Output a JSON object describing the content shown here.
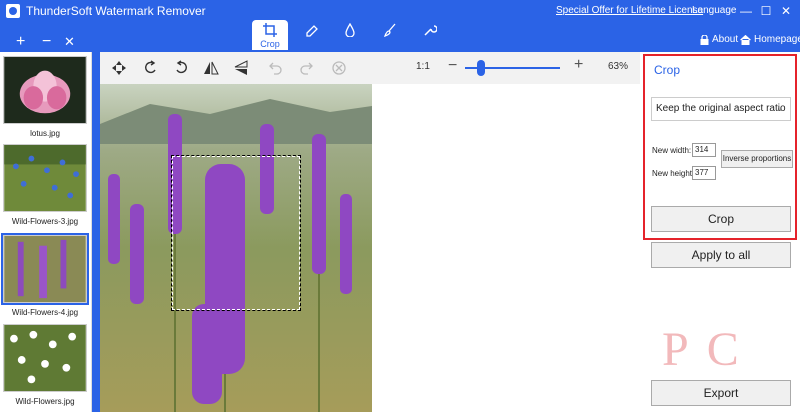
{
  "app": {
    "title": "ThunderSoft Watermark Remover",
    "special_offer": "Special Offer for Lifetime License",
    "language": "Language",
    "about": "About",
    "homepage": "Homepage"
  },
  "tools": [
    {
      "name": "crop",
      "label": "Crop",
      "active": true
    },
    {
      "name": "eraser",
      "label": ""
    },
    {
      "name": "fill",
      "label": ""
    },
    {
      "name": "brush",
      "label": ""
    },
    {
      "name": "wrench",
      "label": ""
    }
  ],
  "sidebar": {
    "files": [
      {
        "caption": "lotus.jpg",
        "selected": false
      },
      {
        "caption": "Wild-Flowers-3.jpg",
        "selected": false
      },
      {
        "caption": "Wild-Flowers-4.jpg",
        "selected": true
      },
      {
        "caption": "Wild-Flowers.jpg",
        "selected": false
      }
    ]
  },
  "toolbar": {
    "ratio_label": "1:1",
    "zoom_percent": "63%",
    "zoom_level": 0.13
  },
  "crop_panel": {
    "title": "Crop",
    "aspect_option": "Keep the original aspect ratio",
    "width_label": "New width:",
    "width_value": "314",
    "height_label": "New height:",
    "height_value": "377",
    "inverse_label": "Inverse proportions",
    "crop_button": "Crop"
  },
  "actions": {
    "apply_all": "Apply to all",
    "export": "Export"
  },
  "colors": {
    "accent": "#2b63e6",
    "highlight_border": "#e5232b"
  }
}
